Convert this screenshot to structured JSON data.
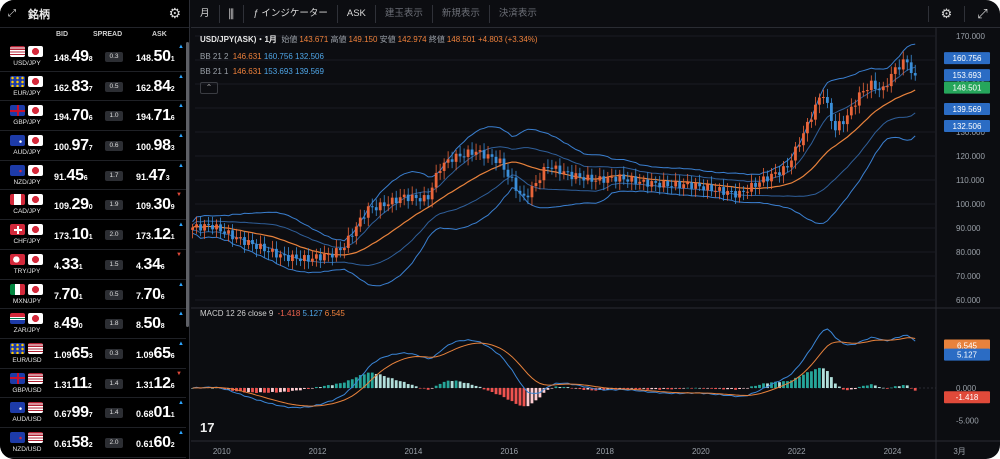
{
  "sidebar": {
    "title": "銘柄",
    "expand_icon": "expand-icon",
    "settings_icon": "gear-icon",
    "columns": {
      "bid": "BID",
      "spread": "SPREAD",
      "ask": "ASK"
    },
    "rows": [
      {
        "pair": "USD/JPY",
        "flags": [
          "us",
          "jp"
        ],
        "bid": [
          "148.",
          "49",
          "8"
        ],
        "spread": "0.3",
        "ask": [
          "148.",
          "50",
          "1"
        ],
        "arrow": "up"
      },
      {
        "pair": "EUR/JPY",
        "flags": [
          "eu",
          "jp"
        ],
        "bid": [
          "162.",
          "83",
          "7"
        ],
        "spread": "0.5",
        "ask": [
          "162.",
          "84",
          "2"
        ],
        "arrow": "up"
      },
      {
        "pair": "GBP/JPY",
        "flags": [
          "gb",
          "jp"
        ],
        "bid": [
          "194.",
          "70",
          "6"
        ],
        "spread": "1.0",
        "ask": [
          "194.",
          "71",
          "6"
        ],
        "arrow": "up"
      },
      {
        "pair": "AUD/JPY",
        "flags": [
          "au",
          "jp"
        ],
        "bid": [
          "100.",
          "97",
          "7"
        ],
        "spread": "0.6",
        "ask": [
          "100.",
          "98",
          "3"
        ],
        "arrow": "up"
      },
      {
        "pair": "NZD/JPY",
        "flags": [
          "nz",
          "jp"
        ],
        "bid": [
          "91.",
          "45",
          "6"
        ],
        "spread": "1.7",
        "ask": [
          "91.",
          "47",
          "3"
        ],
        "arrow": "up"
      },
      {
        "pair": "CAD/JPY",
        "flags": [
          "ca",
          "jp"
        ],
        "bid": [
          "109.",
          "29",
          "0"
        ],
        "spread": "1.9",
        "ask": [
          "109.",
          "30",
          "9"
        ],
        "arrow": "dn"
      },
      {
        "pair": "CHF/JPY",
        "flags": [
          "ch",
          "jp"
        ],
        "bid": [
          "173.",
          "10",
          "1"
        ],
        "spread": "2.0",
        "ask": [
          "173.",
          "12",
          "1"
        ],
        "arrow": "up"
      },
      {
        "pair": "TRY/JPY",
        "flags": [
          "tr",
          "jp"
        ],
        "bid": [
          "4.",
          "33",
          "1"
        ],
        "spread": "1.5",
        "ask": [
          "4.",
          "34",
          "6"
        ],
        "arrow": "dn"
      },
      {
        "pair": "MXN/JPY",
        "flags": [
          "mx",
          "jp"
        ],
        "bid": [
          "7.",
          "70",
          "1"
        ],
        "spread": "0.5",
        "ask": [
          "7.",
          "70",
          "6"
        ],
        "arrow": "up"
      },
      {
        "pair": "ZAR/JPY",
        "flags": [
          "za",
          "jp"
        ],
        "bid": [
          "8.",
          "49",
          "0"
        ],
        "spread": "1.8",
        "ask": [
          "8.",
          "50",
          "8"
        ],
        "arrow": "up"
      },
      {
        "pair": "EUR/USD",
        "flags": [
          "eu",
          "us"
        ],
        "bid": [
          "1.09",
          "65",
          "3"
        ],
        "spread": "0.3",
        "ask": [
          "1.09",
          "65",
          "6"
        ],
        "arrow": "up"
      },
      {
        "pair": "GBP/USD",
        "flags": [
          "gb",
          "us"
        ],
        "bid": [
          "1.31",
          "11",
          "2"
        ],
        "spread": "1.4",
        "ask": [
          "1.31",
          "12",
          "6"
        ],
        "arrow": "dn"
      },
      {
        "pair": "AUD/USD",
        "flags": [
          "au",
          "us"
        ],
        "bid": [
          "0.67",
          "99",
          "7"
        ],
        "spread": "1.4",
        "ask": [
          "0.68",
          "01",
          "1"
        ],
        "arrow": "up"
      },
      {
        "pair": "NZD/USD",
        "flags": [
          "nz",
          "us"
        ],
        "bid": [
          "0.61",
          "58",
          "2"
        ],
        "spread": "2.0",
        "ask": [
          "0.61",
          "60",
          "2"
        ],
        "arrow": "up"
      }
    ]
  },
  "toolbar": {
    "timeframe": "月",
    "candle_icon": "candlestick-icon",
    "indicator_icon": "function-icon",
    "indicator_label": "インジケーター",
    "side": "ASK",
    "btn1": "建玉表示",
    "btn2": "新規表示",
    "btn3": "決済表示",
    "settings_icon": "gear-icon",
    "fullscreen_icon": "fullscreen-icon"
  },
  "legend": {
    "symbol": "USD/JPY(ASK)・1月",
    "open_label": "始値",
    "open": "143.671",
    "high_label": "高値",
    "high": "149.150",
    "low_label": "安値",
    "low": "142.974",
    "close_label": "終値",
    "close": "148.501",
    "change": "+4.803 (+3.34%)",
    "bb1_label": "BB 21 2",
    "bb1_a": "146.631",
    "bb1_b": "160.756",
    "bb1_c": "132.506",
    "bb2_label": "BB 21 1",
    "bb2_a": "146.631",
    "bb2_b": "153.693",
    "bb2_c": "139.569",
    "macd_label": "MACD 12 26 close 9",
    "macd_a": "-1.418",
    "macd_b": "5.127",
    "macd_c": "6.545"
  },
  "colors": {
    "up": "#e8653a",
    "down": "#3b8fd9",
    "bb": "#3a7fd0",
    "mid": "#e8823c",
    "macd_pos": "#26a69a",
    "macd_neg": "#ef5350"
  },
  "chart_data": {
    "type": "line",
    "ylim": [
      60,
      170
    ],
    "yticks": [
      "170.000",
      "160.000",
      "150.000",
      "140.000",
      "130.000",
      "120.000",
      "110.000",
      "100.000",
      "90.000",
      "80.000",
      "70.000",
      "60.000"
    ],
    "xticks": [
      "2010",
      "2012",
      "2014",
      "2016",
      "2018",
      "2020",
      "2022",
      "2024",
      "3月"
    ],
    "price_tags": [
      {
        "value": 160.756,
        "text": "160.756"
      },
      {
        "value": 153.693,
        "text": "153.693"
      },
      {
        "value": 148.501,
        "text": "148.501"
      },
      {
        "value": 139.569,
        "text": "139.569"
      },
      {
        "value": 132.506,
        "text": "132.506"
      }
    ],
    "macd_yticks": [
      "0.000",
      "-5.000"
    ],
    "macd_tags": [
      {
        "value": 6.545,
        "text": "6.545"
      },
      {
        "value": 5.127,
        "text": "5.127"
      },
      {
        "value": -1.418,
        "text": "-1.418"
      }
    ],
    "series": [
      {
        "name": "USD/JPY(ASK)",
        "x": [
          2009.5,
          2010.0,
          2010.5,
          2011.0,
          2011.5,
          2012.0,
          2012.5,
          2012.75,
          2013.0,
          2013.25,
          2013.5,
          2014.0,
          2014.5,
          2014.75,
          2015.0,
          2015.5,
          2016.0,
          2016.25,
          2016.5,
          2016.75,
          2017.0,
          2017.5,
          2018.0,
          2018.5,
          2019.0,
          2019.5,
          2020.0,
          2020.5,
          2021.0,
          2021.5,
          2022.0,
          2022.25,
          2022.5,
          2022.75,
          2023.0,
          2023.25,
          2023.5,
          2023.75,
          2024.0,
          2024.25,
          2024.5,
          2024.75
        ],
        "values": [
          90,
          91,
          86,
          82,
          78,
          77,
          79,
          82,
          90,
          98,
          99,
          103,
          102,
          115,
          119,
          122,
          118,
          110,
          102,
          108,
          116,
          112,
          110,
          111,
          109,
          108,
          108,
          106,
          104,
          110,
          115,
          125,
          136,
          147,
          131,
          136,
          145,
          150,
          147,
          156,
          160,
          149
        ]
      }
    ]
  }
}
